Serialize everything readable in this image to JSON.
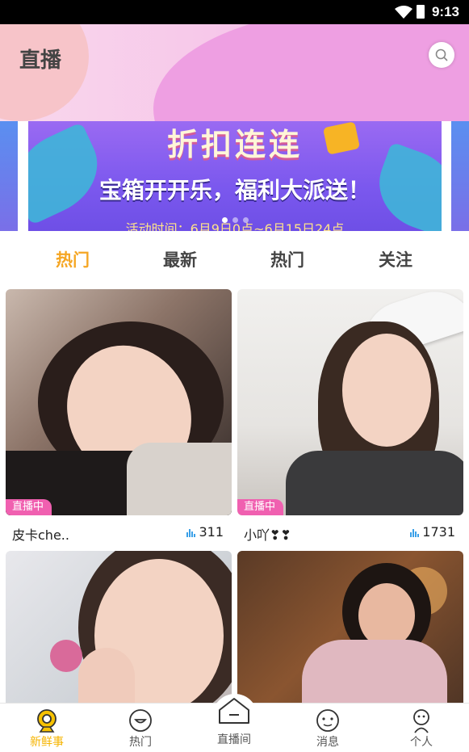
{
  "status_bar": {
    "time": "9:13"
  },
  "header": {
    "title": "直播"
  },
  "banner": {
    "headline": "折扣连连",
    "subline": "宝箱开开乐，福利大派送！",
    "date_text": "活动时间：6月9日0点~6月15日24点"
  },
  "tabs": [
    {
      "label": "热门",
      "active": true
    },
    {
      "label": "最新",
      "active": false
    },
    {
      "label": "热门",
      "active": false
    },
    {
      "label": "关注",
      "active": false
    }
  ],
  "cards": [
    {
      "name": "皮卡che..",
      "views": "311",
      "badge": "直播中"
    },
    {
      "name": "小吖❣❣",
      "views": "1731",
      "badge": "直播中"
    },
    {
      "name": "",
      "views": "",
      "badge": ""
    },
    {
      "name": "",
      "views": "",
      "badge": ""
    }
  ],
  "bottom_nav": [
    {
      "label": "新鲜事",
      "icon": "camera-icon",
      "active": true
    },
    {
      "label": "热门",
      "icon": "smile-face-icon",
      "active": false
    },
    {
      "label": "直播间",
      "icon": "live-room-icon",
      "active": false
    },
    {
      "label": "消息",
      "icon": "message-face-icon",
      "active": false
    },
    {
      "label": "个人",
      "icon": "person-icon",
      "active": false
    }
  ],
  "colors": {
    "accent": "#f5a623",
    "badge": "#f060b0",
    "views_icon": "#3aa0e8"
  }
}
